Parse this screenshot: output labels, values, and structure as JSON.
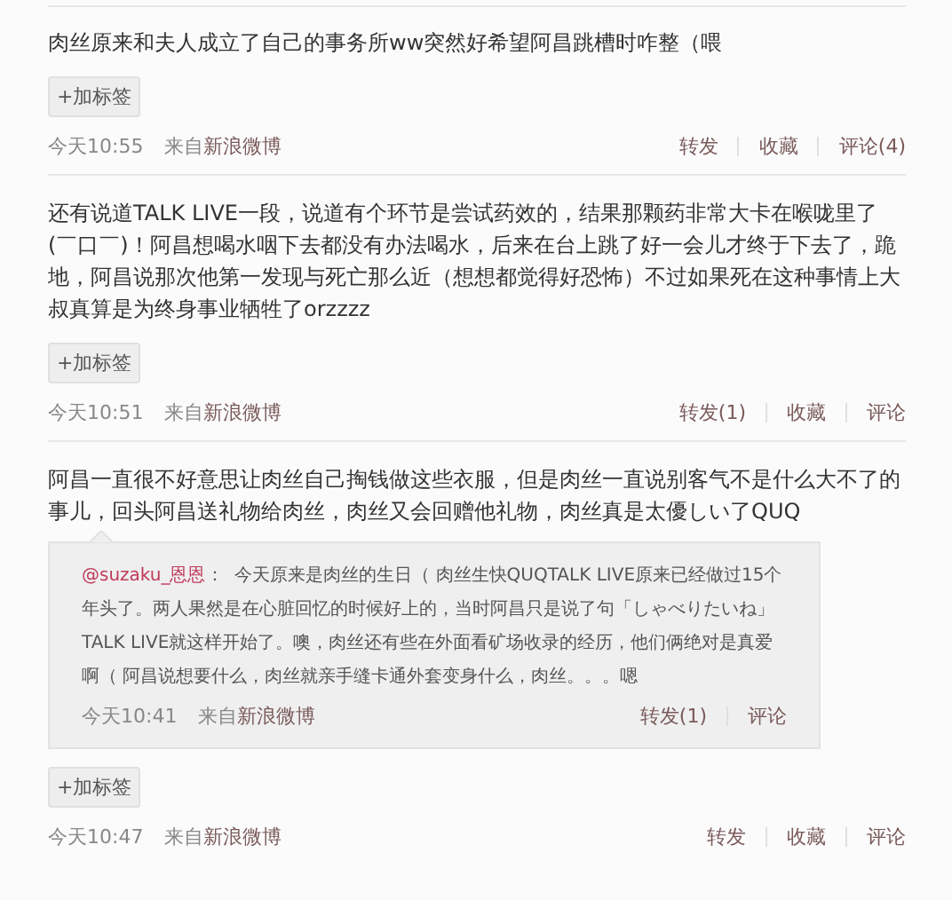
{
  "posts": [
    {
      "text": "肉丝原来和夫人成立了自己的事务所ww突然好希望阿昌跳槽时咋整（喂",
      "tag_button": "+加标签",
      "time": "今天10:55",
      "source_prefix": "来自",
      "source": "新浪微博",
      "actions": [
        "转发",
        "收藏",
        "评论(4)"
      ]
    },
    {
      "text": "还有说道TALK LIVE一段，说道有个环节是尝试药效的，结果那颗药非常大卡在喉咙里了(￣口￣)！阿昌想喝水咽下去都没有办法喝水，后来在台上跳了好一会儿才终于下去了，跪地，阿昌说那次他第一发现与死亡那么近（想想都觉得好恐怖）不过如果死在这种事情上大叔真算是为终身事业牺牲了orzzzz",
      "tag_button": "+加标签",
      "time": "今天10:51",
      "source_prefix": "来自",
      "source": "新浪微博",
      "actions": [
        "转发(1)",
        "收藏",
        "评论"
      ]
    },
    {
      "text": "阿昌一直很不好意思让肉丝自己掏钱做这些衣服，但是肉丝一直说别客气不是什么大不了的事儿，回头阿昌送礼物给肉丝，肉丝又会回赠他礼物，肉丝真是太優しい了QUQ",
      "quote": {
        "author": "@suzaku_恩恩",
        "text": "：  今天原来是肉丝的生日（ 肉丝生快QUQTALK LIVE原来已经做过15个年头了。两人果然是在心脏回忆的时候好上的，当时阿昌只是说了句「しゃべりたいね」TALK LIVE就这样开始了。噢，肉丝还有些在外面看矿场收录的经历，他们俩绝对是真爱啊（ 阿昌说想要什么，肉丝就亲手缝卡通外套变身什么，肉丝。。。嗯",
        "time": "今天10:41",
        "source_prefix": "来自",
        "source": "新浪微博",
        "actions": [
          "转发(1)",
          "评论"
        ]
      },
      "tag_button": "+加标签",
      "time": "今天10:47",
      "source_prefix": "来自",
      "source": "新浪微博",
      "actions": [
        "转发",
        "收藏",
        "评论"
      ]
    }
  ]
}
